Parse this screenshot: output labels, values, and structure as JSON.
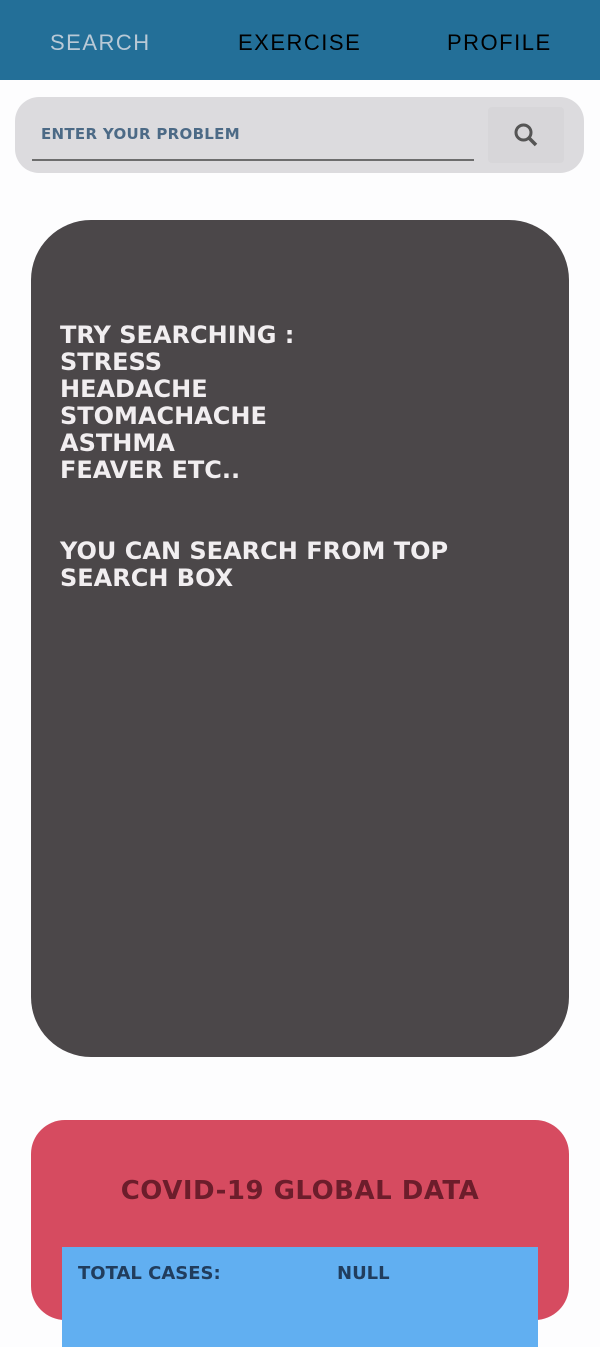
{
  "nav": {
    "tabs": [
      {
        "label": "SEARCH",
        "active": true
      },
      {
        "label": "EXERCISE"
      },
      {
        "label": "PROFILE"
      }
    ]
  },
  "search": {
    "placeholder": "ENTER YOUR PROBLEM",
    "icon": "search-icon"
  },
  "tips": {
    "lines": [
      "TRY SEARCHING :",
      "STRESS",
      "HEADACHE",
      "STOMACHACHE",
      "ASTHMA",
      "FEAVER ETC.."
    ],
    "hint": [
      "YOU CAN SEARCH FROM TOP",
      "SEARCH BOX"
    ]
  },
  "covid": {
    "title": "COVID-19 GLOBAL DATA",
    "rows": [
      {
        "label": "TOTAL CASES:",
        "value": "NULL"
      }
    ]
  }
}
